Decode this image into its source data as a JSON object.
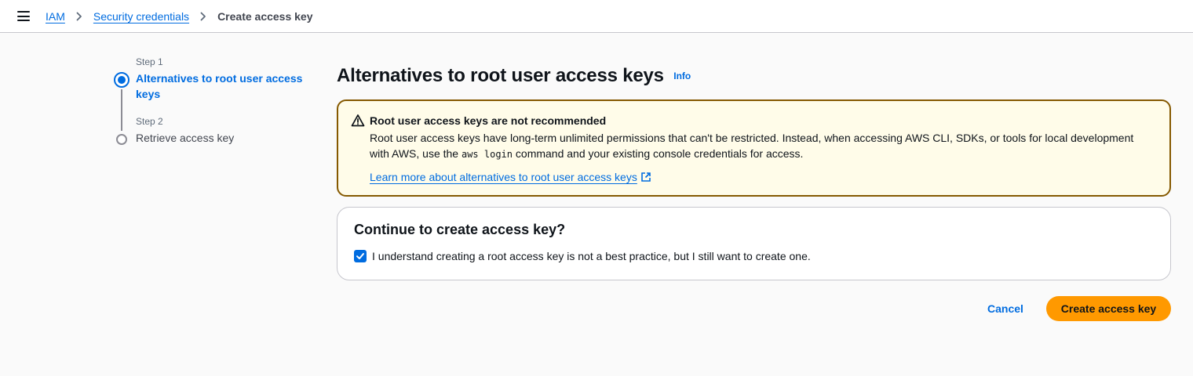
{
  "breadcrumb": {
    "items": [
      {
        "label": "IAM"
      },
      {
        "label": "Security credentials"
      },
      {
        "label": "Create access key"
      }
    ]
  },
  "steps": [
    {
      "number_label": "Step 1",
      "title": "Alternatives to root user access keys",
      "state": "active"
    },
    {
      "number_label": "Step 2",
      "title": "Retrieve access key",
      "state": "inactive"
    }
  ],
  "main": {
    "title": "Alternatives to root user access keys",
    "info_link": "Info"
  },
  "alert": {
    "icon": "warning-icon",
    "heading": "Root user access keys are not recommended",
    "body_part1": "Root user access keys have long-term unlimited permissions that can't be restricted. Instead, when accessing AWS CLI, SDKs, or tools for local development with AWS, use the ",
    "body_code": "aws login",
    "body_part2": " command and your existing console credentials for access.",
    "link": "Learn more about alternatives to root user access keys"
  },
  "confirm": {
    "title": "Continue to create access key?",
    "checkbox_label": "I understand creating a root access key is not a best practice, but I still want to create one.",
    "checked": true
  },
  "actions": {
    "cancel_label": "Cancel",
    "create_label": "Create access key"
  },
  "colors": {
    "link": "#006ce0",
    "primary_button": "#ff9900",
    "warning_bg": "#fffce9",
    "warning_border": "#855900"
  }
}
